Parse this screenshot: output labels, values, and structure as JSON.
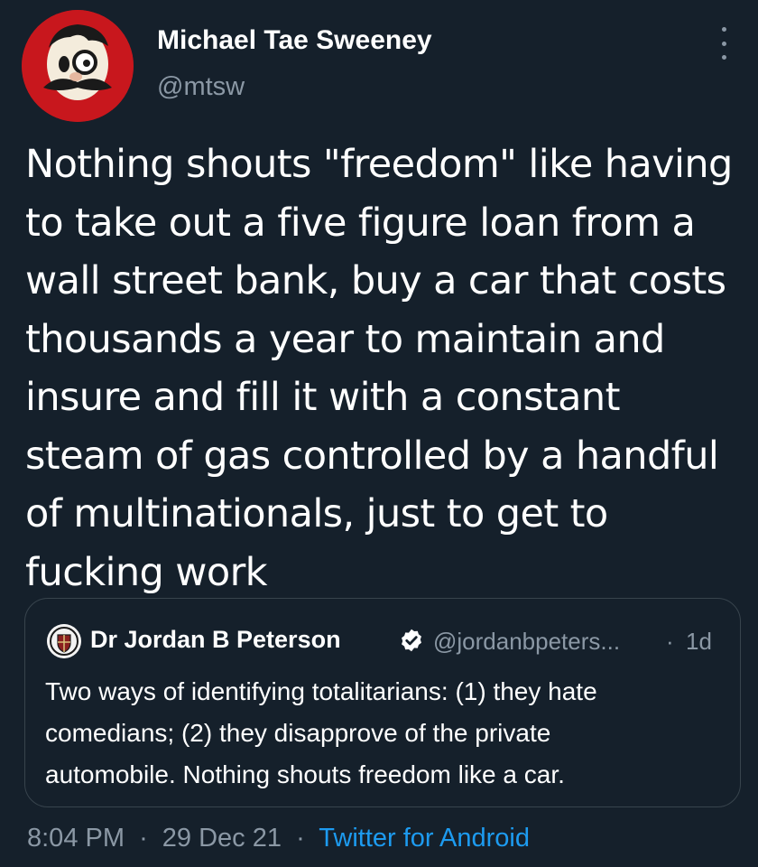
{
  "author": {
    "display_name": "Michael Tae Sweeney",
    "handle": "@mtsw",
    "avatar_icon": "mascot-avatar-icon",
    "avatar_color": "#c8171d"
  },
  "tweet": {
    "lines": [
      "Nothing shouts \"freedom\" like having",
      "to take out a five figure loan from a",
      "wall street bank, buy a car that costs",
      "thousands a year to maintain and",
      "insure and fill it with a constant",
      "steam of gas controlled by a handful",
      "of multinationals, just to get to",
      "fucking work"
    ]
  },
  "quoted_tweet": {
    "display_name": "Dr Jordan B Peterson",
    "verified_icon": "verified-badge-icon",
    "handle": "@jordanbpeters...",
    "separator": "·",
    "age": "1d",
    "lines": [
      "Two ways of identifying totalitarians: (1) they hate",
      "comedians; (2) they disapprove of the private",
      "automobile.  Nothing shouts freedom like a car."
    ]
  },
  "footer": {
    "time": "8:04 PM",
    "date": "29 Dec 21",
    "separator": "·",
    "source": "Twitter for Android"
  },
  "colors": {
    "background": "#15202b",
    "muted_text": "#8b98a5",
    "link": "#1d9bf0",
    "border": "#38444d"
  }
}
